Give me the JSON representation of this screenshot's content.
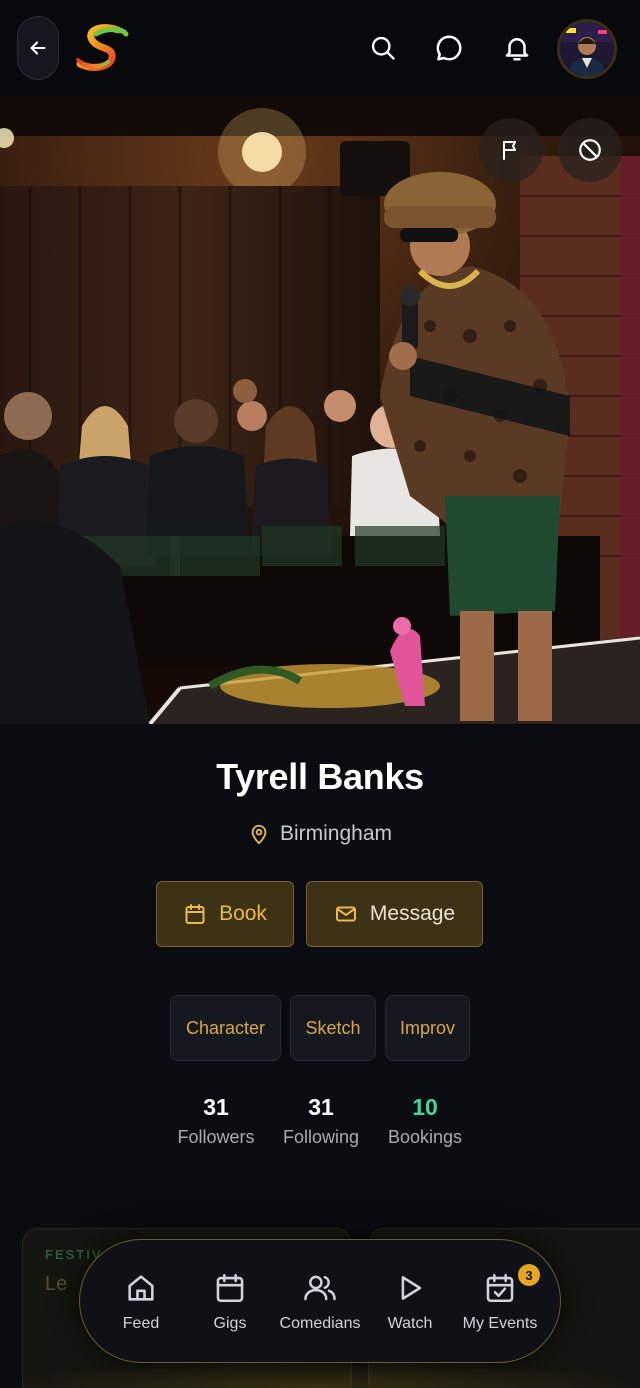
{
  "profile": {
    "name": "Tyrell Banks",
    "location": "Birmingham",
    "actions": {
      "book_label": "Book",
      "message_label": "Message"
    },
    "tags": [
      "Character",
      "Sketch",
      "Improv"
    ],
    "stats": [
      {
        "value": "31",
        "label": "Followers"
      },
      {
        "value": "31",
        "label": "Following"
      },
      {
        "value": "10",
        "label": "Bookings"
      }
    ]
  },
  "cards": [
    {
      "kicker": "FESTIV",
      "title": "Le"
    }
  ],
  "nav": {
    "items": [
      {
        "label": "Feed",
        "icon": "home-icon"
      },
      {
        "label": "Gigs",
        "icon": "calendar-icon"
      },
      {
        "label": "Comedians",
        "icon": "users-icon"
      },
      {
        "label": "Watch",
        "icon": "play-icon"
      },
      {
        "label": "My Events",
        "icon": "calendar-check-icon",
        "badge": "3"
      }
    ]
  },
  "colors": {
    "accent": "#e9b949",
    "bookings": "#3fd6a0",
    "background": "#0b0c11"
  }
}
